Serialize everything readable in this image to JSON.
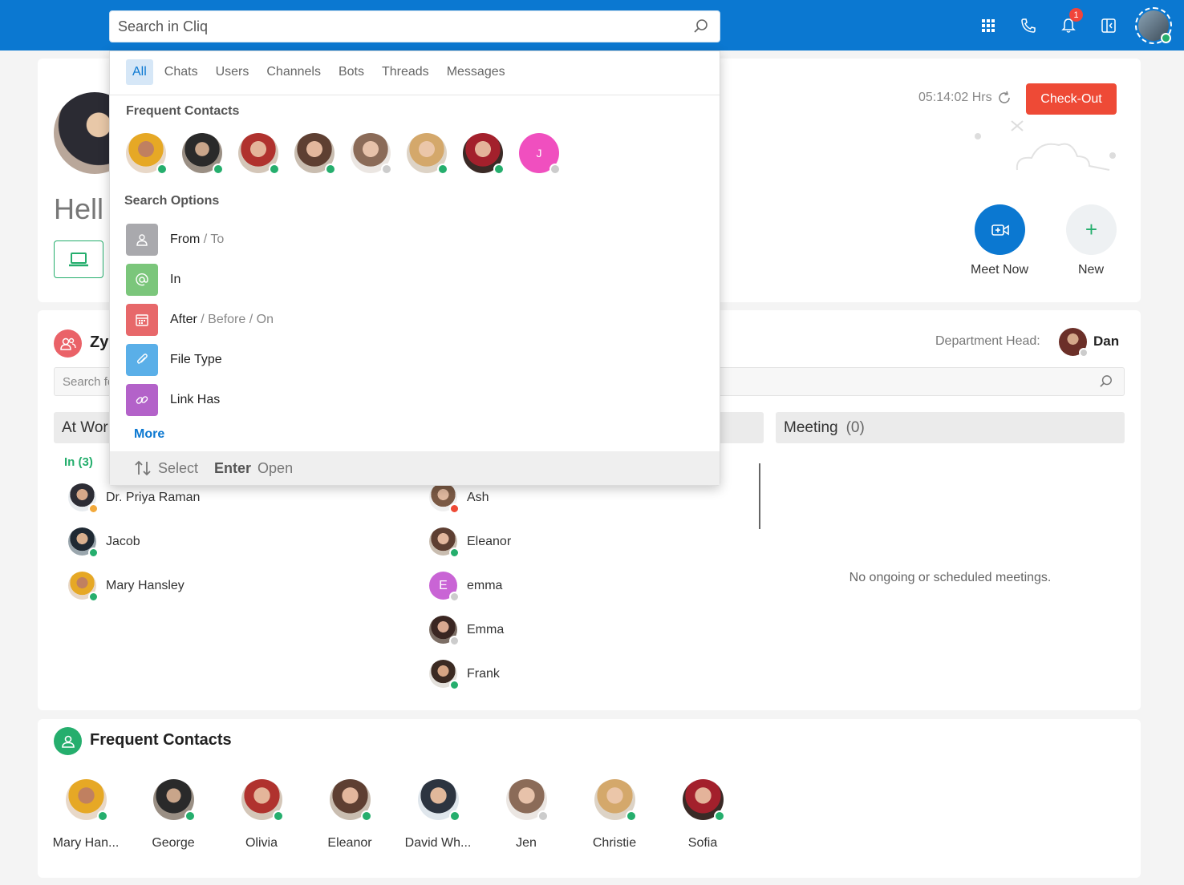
{
  "topbar": {
    "search_placeholder": "Search in Cliq",
    "notification_count": "1",
    "icons": [
      "apps-grid-icon",
      "phone-icon",
      "bell-icon",
      "panel-collapse-icon"
    ]
  },
  "profile": {
    "greeting": "Hell",
    "timer": "05:14:02 Hrs",
    "checkout_label": "Check-Out",
    "meet_now_label": "Meet Now",
    "new_label": "New"
  },
  "team": {
    "title": "Zy",
    "dept_head_label": "Department Head:",
    "dept_head_name": "Dan",
    "search_placeholder": "Search fo",
    "col_at_work": "At Wor",
    "in_label": "In (3)",
    "meeting_label": "Meeting",
    "meeting_count": "(0)",
    "no_meetings": "No ongoing or scheduled meetings.",
    "left_people": [
      {
        "name": "Dr. Priya Raman",
        "status": "away"
      },
      {
        "name": "Jacob",
        "status": "online"
      },
      {
        "name": "Mary  Hansley",
        "status": "online"
      }
    ],
    "right_people": [
      {
        "name": "Ash",
        "status": "busy"
      },
      {
        "name": "Eleanor",
        "status": "online"
      },
      {
        "name": "emma",
        "status": "offline",
        "initial": "E"
      },
      {
        "name": "Emma",
        "status": "offline"
      },
      {
        "name": "Frank",
        "status": "online"
      }
    ]
  },
  "frequent": {
    "title": "Frequent Contacts",
    "contacts": [
      {
        "name": "Mary Han...",
        "status": "online"
      },
      {
        "name": "George",
        "status": "online"
      },
      {
        "name": "Olivia",
        "status": "online"
      },
      {
        "name": "Eleanor",
        "status": "online"
      },
      {
        "name": "David Wh...",
        "status": "online"
      },
      {
        "name": "Jen",
        "status": "offline"
      },
      {
        "name": "Christie",
        "status": "online"
      },
      {
        "name": "Sofia",
        "status": "online"
      }
    ]
  },
  "dropdown": {
    "tabs": [
      "All",
      "Chats",
      "Users",
      "Channels",
      "Bots",
      "Threads",
      "Messages"
    ],
    "active_tab": "All",
    "frequent_label": "Frequent Contacts",
    "frequent_initial": "J",
    "options_label": "Search Options",
    "options": {
      "from": "From",
      "to": "/ To",
      "in": "In",
      "after": "After",
      "before_on": "/ Before / On",
      "file_type": "File Type",
      "link_has": "Link Has"
    },
    "more_label": "More",
    "footer": {
      "select_key": "Select",
      "enter_key": "Enter",
      "open_label": "Open"
    }
  },
  "colors": {
    "brand": "#0b78d1",
    "online": "#25ae6d",
    "away": "#f2a93b",
    "busy": "#ee4a36",
    "offline": "#cccccc"
  }
}
